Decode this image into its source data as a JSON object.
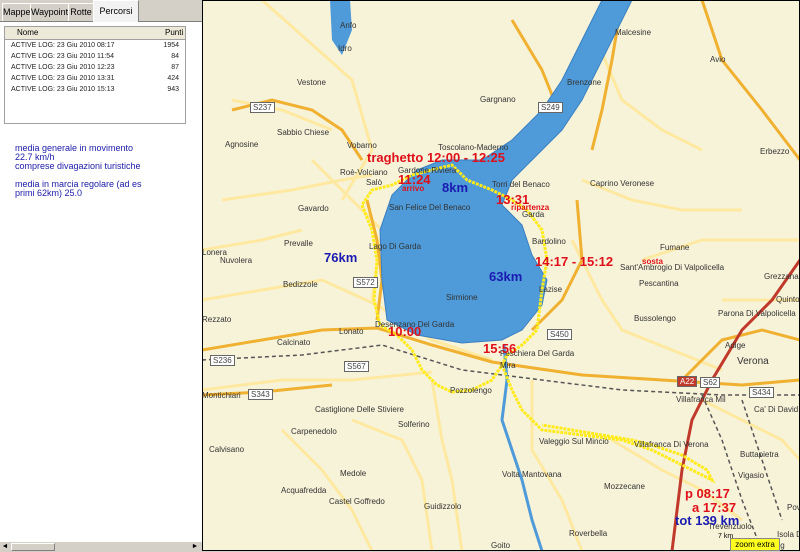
{
  "tabs": [
    "Mappe",
    "Waypoint",
    "Rotte",
    "Percorsi (5)"
  ],
  "table": {
    "headers": {
      "name": "Nome",
      "points": "Punti"
    },
    "rows": [
      {
        "name": "ACTIVE LOG: 23 Giu 2010 08:17",
        "points": "1954"
      },
      {
        "name": "ACTIVE LOG: 23 Giu 2010 11:54",
        "points": "84"
      },
      {
        "name": "ACTIVE LOG: 23 Giu 2010 12:23",
        "points": "87"
      },
      {
        "name": "ACTIVE LOG: 23 Giu 2010 13:31",
        "points": "424"
      },
      {
        "name": "ACTIVE LOG: 23 Giu 2010 15:13",
        "points": "943"
      }
    ]
  },
  "stats": {
    "line1": "media generale in movimento",
    "line2": "22.7 km/h",
    "line3": "comprese divagazioni turistiche",
    "line4": "media in marcia regolare (ad es",
    "line5": "primi 62km) 25.0"
  },
  "scroll": {
    "left": "◄",
    "right": "►"
  },
  "towns": {
    "anfo": "Anfo",
    "idro": "Idro",
    "malcesine": "Malcesine",
    "avio": "Avio",
    "vestone": "Vestone",
    "gargnano": "Gargnano",
    "brenzone": "Brenzone",
    "agnosine": "Agnosine",
    "sabbio": "Sabbio Chiese",
    "vobarno": "Vobarno",
    "toscolano": "Toscolano-Maderno",
    "gardone": "Gardone Riviera",
    "roe": "Roè-Volciano",
    "salo": "Salò",
    "torri": "Torri del Benaco",
    "caprino": "Caprino Veronese",
    "erbezzo": "Erbezzo",
    "gavardo": "Gavardo",
    "sanfelice": "San Felice Del Benaco",
    "garda": "Garda",
    "prevalle": "Prevalle",
    "nuvolera": "Nuvolera",
    "lonera": "Lonera",
    "lagodigarda": "Lago Di Garda",
    "bardolino": "Bardolino",
    "fumane": "Fumane",
    "santambrogio": "Sant'Ambrogio Di Valpolicella",
    "grezzana": "Grezzana",
    "bedizzole": "Bedizzole",
    "sirmione": "Sirmione",
    "lazise": "Lazise",
    "pescantina": "Pescantina",
    "bussolengo": "Bussolengo",
    "quinto": "Quinto",
    "parona": "Parona Di Valpolicella",
    "rezzato": "Rezzato",
    "lonato": "Lonato",
    "desenzano": "Desenzano Del Garda",
    "calcinato": "Calcinato",
    "peschiera": "Peschiera Del Garda",
    "mira": "Mira",
    "adige": "Adige",
    "verona": "Verona",
    "montichiari": "Montichiari",
    "pozzolengo": "Pozzolengo",
    "villafrancamil": "Villafranca Mil",
    "cadavid": "Ca' Di David",
    "castiglione": "Castiglione Delle Stiviere",
    "carpenedolo": "Carpenedolo",
    "solferino": "Solferino",
    "valeggio": "Valeggio Sul Mincio",
    "villafranca": "Villafranca Di Verona",
    "buttapietra": "Buttapietra",
    "calvisano": "Calvisano",
    "medole": "Medole",
    "vigasio": "Vigasio",
    "mozzecane": "Mozzecane",
    "acquafredda": "Acquafredda",
    "guidizzolo": "Guidizzolo",
    "volta": "Volta Mantovana",
    "castelgoffredo": "Castel Goffredo",
    "trevenzuolo": "Trevenzuolo",
    "isola": "Isola D",
    "roverbella": "Roverbella",
    "goito": "Goito",
    "nogara": "Nog",
    "povegl": "Povegl"
  },
  "roads": {
    "s237": "S237",
    "s249": "S249",
    "s572": "S572",
    "s450": "S450",
    "s236": "S236",
    "s343": "S343",
    "s567": "S567",
    "a22": "A22",
    "s62": "S62",
    "s434": "S434"
  },
  "annotations": {
    "traghetto": "traghetto  12:00 - 12:25",
    "t1124": "11:24",
    "arrivo": "arrivo",
    "km8": "8km",
    "t1331": "13:31",
    "ripartenza": "ripartenza",
    "km76": "76km",
    "t1417": "14:17 - 15:12",
    "sosta": "sosta",
    "km63": "63km",
    "t1000": "10:00",
    "t1556": "15:56",
    "p0817": "p 08:17",
    "a1737": "a 17:37",
    "tot": "tot 139 km"
  },
  "scale": "7 km",
  "zoom_label": "zoom extra",
  "colors": {
    "lake": "#4f9bd9",
    "track": "#ffea1a",
    "road_main": "#f0b030",
    "road_minor": "#ffe9a0",
    "railway": "#555555",
    "annotation_red": "#e0101a",
    "annotation_blue": "#1a1ab0"
  }
}
